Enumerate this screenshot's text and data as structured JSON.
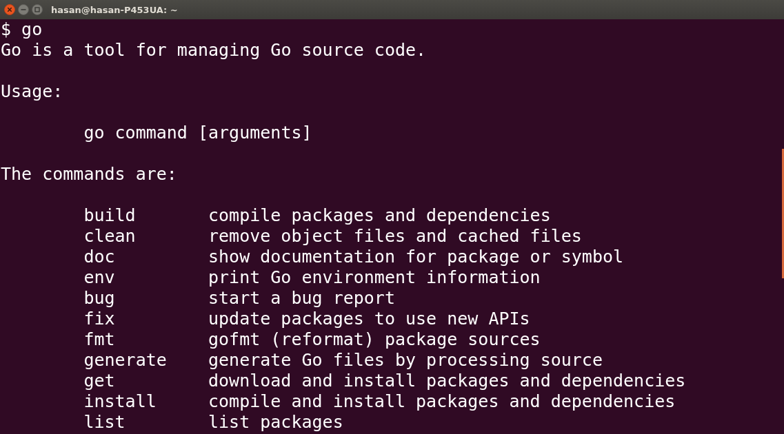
{
  "window": {
    "title": "hasan@hasan-P453UA: ~"
  },
  "terminal": {
    "lines": [
      {
        "kind": "text",
        "text": "$ go"
      },
      {
        "kind": "text",
        "text": "Go is a tool for managing Go source code."
      },
      {
        "kind": "blank"
      },
      {
        "kind": "text",
        "text": "Usage:"
      },
      {
        "kind": "blank"
      },
      {
        "kind": "indented",
        "text": "go command [arguments]"
      },
      {
        "kind": "blank"
      },
      {
        "kind": "text",
        "text": "The commands are:"
      },
      {
        "kind": "blank"
      },
      {
        "kind": "command",
        "name": "build",
        "description": "compile packages and dependencies"
      },
      {
        "kind": "command",
        "name": "clean",
        "description": "remove object files and cached files"
      },
      {
        "kind": "command",
        "name": "doc",
        "description": "show documentation for package or symbol"
      },
      {
        "kind": "command",
        "name": "env",
        "description": "print Go environment information"
      },
      {
        "kind": "command",
        "name": "bug",
        "description": "start a bug report"
      },
      {
        "kind": "command",
        "name": "fix",
        "description": "update packages to use new APIs"
      },
      {
        "kind": "command",
        "name": "fmt",
        "description": "gofmt (reformat) package sources"
      },
      {
        "kind": "command",
        "name": "generate",
        "description": "generate Go files by processing source"
      },
      {
        "kind": "command",
        "name": "get",
        "description": "download and install packages and dependencies"
      },
      {
        "kind": "command",
        "name": "install",
        "description": "compile and install packages and dependencies"
      },
      {
        "kind": "command",
        "name": "list",
        "description": "list packages"
      }
    ]
  }
}
